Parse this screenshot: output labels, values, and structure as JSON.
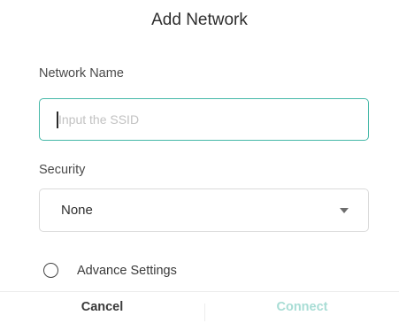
{
  "dialog": {
    "title": "Add Network"
  },
  "network_name": {
    "label": "Network Name",
    "placeholder": "Input the SSID",
    "value": ""
  },
  "security": {
    "label": "Security",
    "selected": "None"
  },
  "advance_settings": {
    "label": "Advance Settings",
    "checked": false
  },
  "footer": {
    "cancel_label": "Cancel",
    "connect_label": "Connect"
  },
  "colors": {
    "accent": "#45b8a8",
    "connect_disabled": "#a8ddd5"
  },
  "icons": {
    "dropdown": "caret-down-icon",
    "radio": "radio-unchecked-icon"
  }
}
